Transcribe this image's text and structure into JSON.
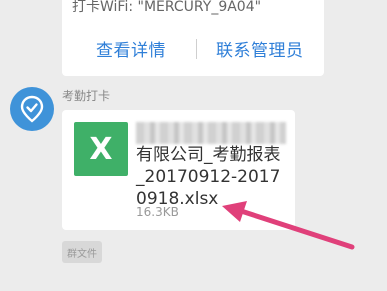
{
  "top_card": {
    "wifi_text": "打卡WiFi: \"MERCURY_9A04\"",
    "action_left": "查看详情",
    "action_right": "联系管理员"
  },
  "message": {
    "sender": "考勤打卡",
    "file": {
      "icon_letter": "X",
      "name": "有限公司_考勤报表_20170912-20170918.xlsx",
      "size": "16.3KB"
    },
    "source_tag": "群文件"
  },
  "colors": {
    "background": "#ececec",
    "link": "#2f7fd8",
    "avatar": "#3f93d9",
    "excel_icon": "#3fb068",
    "arrow": "#e0407a"
  },
  "icons": {
    "avatar": "location-pin-icon",
    "file": "excel-file-icon"
  }
}
